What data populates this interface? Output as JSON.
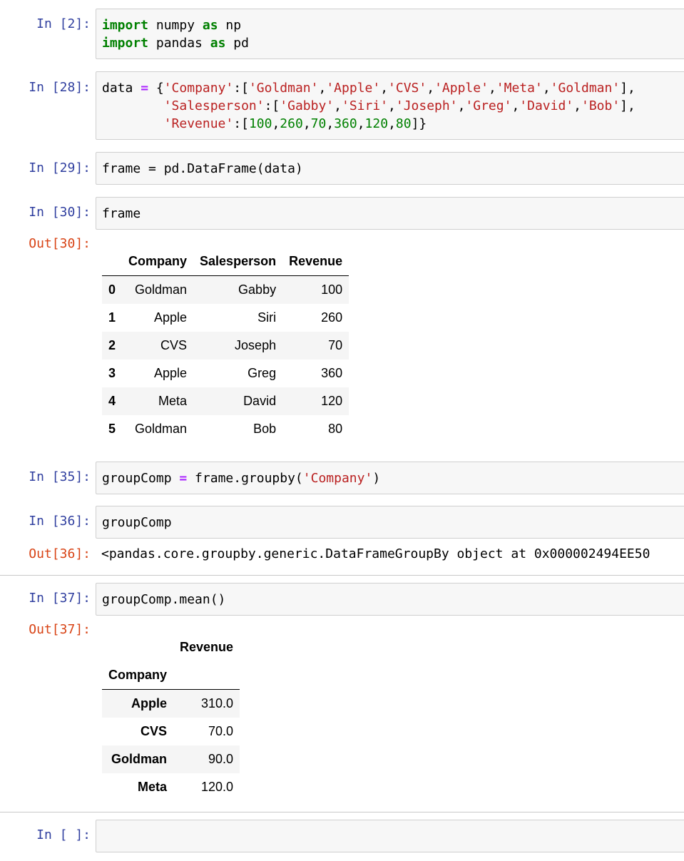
{
  "cells": {
    "c1": {
      "prompt": "In [2]:"
    },
    "c2": {
      "prompt": "In [28]:"
    },
    "c3": {
      "prompt": "In [29]:",
      "code": "frame = pd.DataFrame(data)"
    },
    "c4": {
      "prompt": "In [30]:",
      "code": "frame",
      "out_prompt": "Out[30]:"
    },
    "c5": {
      "prompt": "In [35]:"
    },
    "c6": {
      "prompt": "In [36]:",
      "code": "groupComp",
      "out_prompt": "Out[36]:",
      "output": "<pandas.core.groupby.generic.DataFrameGroupBy object at 0x000002494EE50"
    },
    "c7": {
      "prompt": "In [37]:",
      "code": "groupComp.mean()",
      "out_prompt": "Out[37]:"
    },
    "c8": {
      "prompt": "In [ ]:"
    }
  },
  "code_tokens": {
    "import": "import",
    "as": "as",
    "numpy": " numpy ",
    "np": " np",
    "pandas": " pandas ",
    "pd": " pd",
    "data_assign": "data ",
    "eq": "=",
    "open_brace": " {",
    "k_company": "'Company'",
    "k_salesperson": "'Salesperson'",
    "k_revenue": "'Revenue'",
    "colon_open": ":[",
    "comma": ",",
    "close_comma": "],",
    "close_end": "]}",
    "indent": "        ",
    "companies": [
      "'Goldman'",
      "'Apple'",
      "'CVS'",
      "'Apple'",
      "'Meta'",
      "'Goldman'"
    ],
    "people": [
      "'Gabby'",
      "'Siri'",
      "'Joseph'",
      "'Greg'",
      "'David'",
      "'Bob'"
    ],
    "revenues": [
      "100",
      "260",
      "70",
      "360",
      "120",
      "80"
    ],
    "group_lhs": "groupComp ",
    "group_rhs": " frame.groupby(",
    "group_arg": "'Company'",
    "group_close": ")"
  },
  "table1": {
    "columns": [
      "",
      "Company",
      "Salesperson",
      "Revenue"
    ],
    "rows": [
      [
        "0",
        "Goldman",
        "Gabby",
        "100"
      ],
      [
        "1",
        "Apple",
        "Siri",
        "260"
      ],
      [
        "2",
        "CVS",
        "Joseph",
        "70"
      ],
      [
        "3",
        "Apple",
        "Greg",
        "360"
      ],
      [
        "4",
        "Meta",
        "David",
        "120"
      ],
      [
        "5",
        "Goldman",
        "Bob",
        "80"
      ]
    ]
  },
  "table2": {
    "value_column": "Revenue",
    "index_name": "Company",
    "rows": [
      [
        "Apple",
        "310.0"
      ],
      [
        "CVS",
        "70.0"
      ],
      [
        "Goldman",
        "90.0"
      ],
      [
        "Meta",
        "120.0"
      ]
    ]
  },
  "colors": {
    "in_prompt": "#303f9f",
    "out_prompt": "#d84315",
    "keyword": "#008000",
    "operator": "#aa22ff",
    "string": "#ba2121",
    "cell_bg": "#f7f7f7"
  }
}
